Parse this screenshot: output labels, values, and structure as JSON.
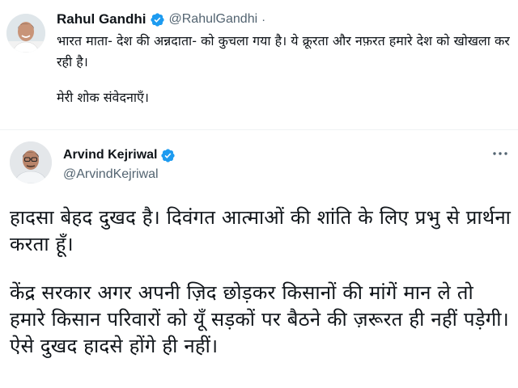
{
  "tweets": [
    {
      "author": {
        "name": "Rahul Gandhi",
        "handle": "@RahulGandhi",
        "separator": "·",
        "verified": true,
        "avatar": "avatar-rahul-gandhi"
      },
      "paragraphs": [
        "भारत माता- देश की अन्नदाता- को कुचला गया है। ये क्रूरता और नफ़रत हमारे देश को खोखला कर रही है।",
        "मेरी शोक संवेदनाएँ।"
      ]
    },
    {
      "author": {
        "name": "Arvind Kejriwal",
        "handle": "@ArvindKejriwal",
        "verified": true,
        "avatar": "avatar-arvind-kejriwal"
      },
      "more_icon": "more-horizontal-icon",
      "paragraphs": [
        "हादसा बेहद दुखद है। दिवंगत आत्माओं की शांति के लिए प्रभु से प्रार्थना करता हूँ।",
        "केंद्र सरकार अगर अपनी ज़िद छोड़कर किसानों की मांगें मान ले तो हमारे किसान परिवारों को यूँ सड़कों पर बैठने की ज़रूरत ही नहीं पड़ेगी। ऐसे दुखद हादसे होंगे ही नहीं।"
      ]
    }
  ],
  "colors": {
    "text": "#0f1419",
    "secondary": "#536471",
    "verified": "#1d9bf0",
    "divider": "#eff3f4"
  }
}
